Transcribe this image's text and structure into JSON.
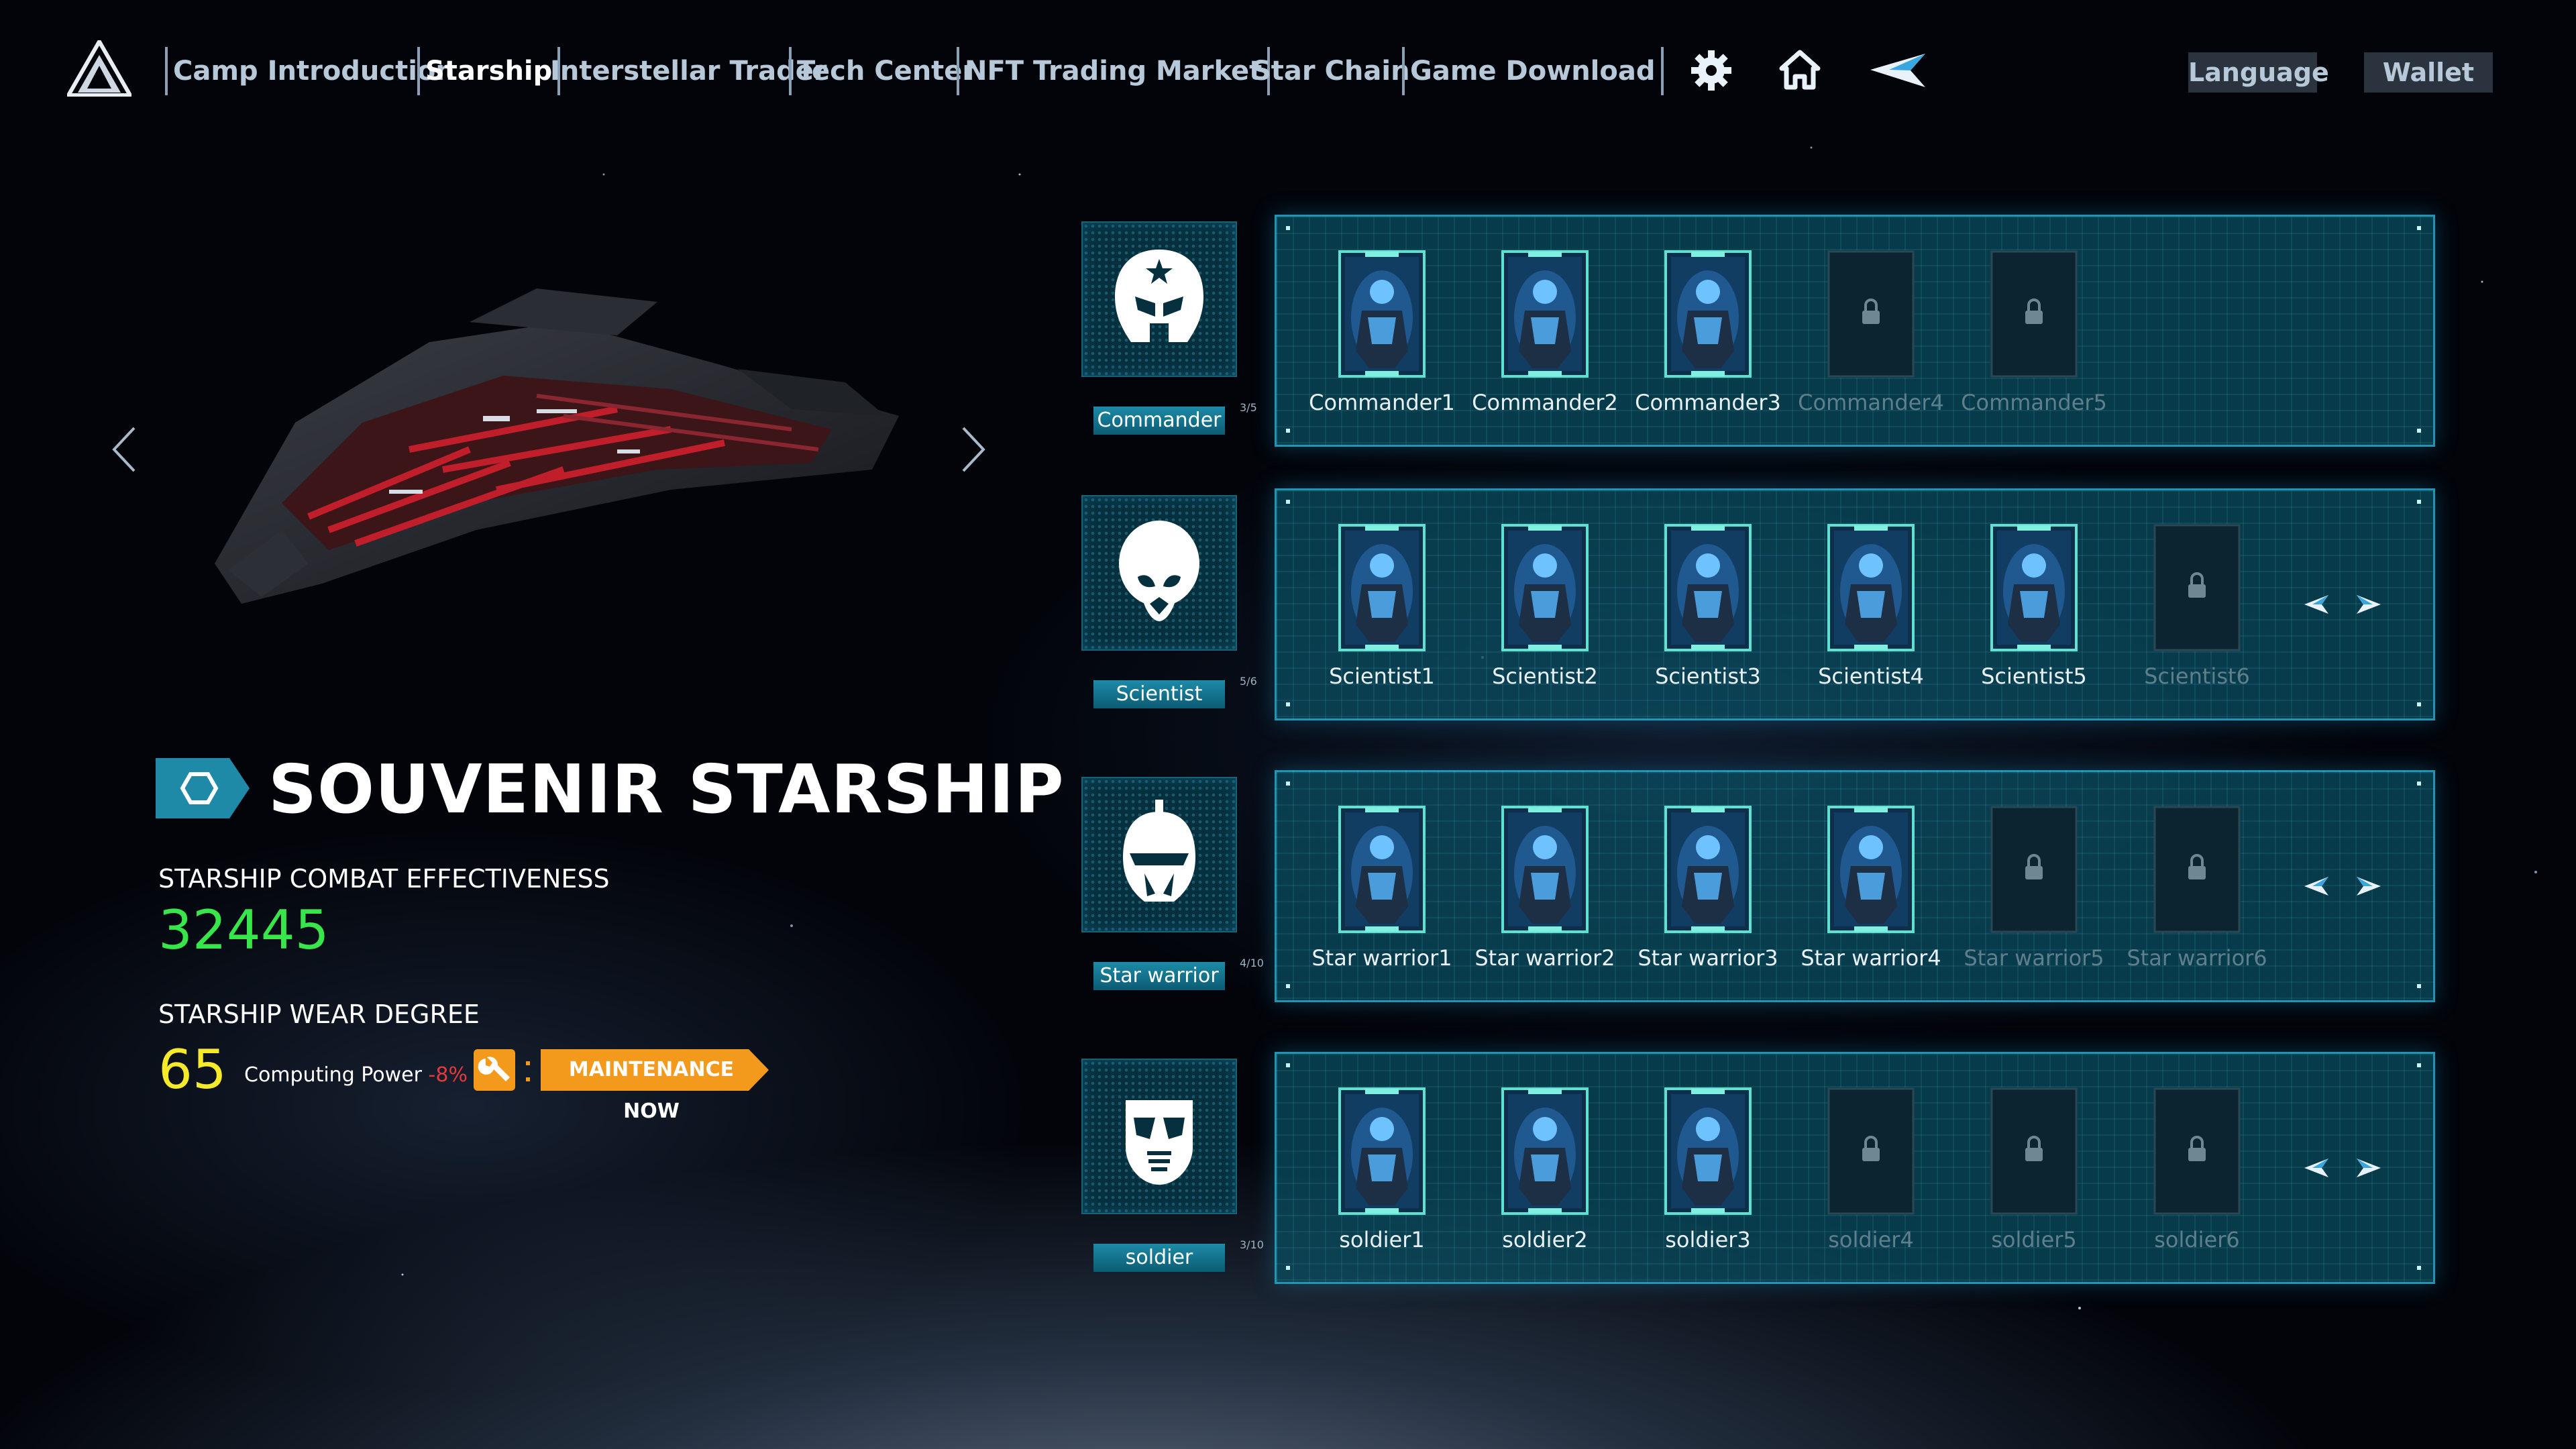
{
  "nav": {
    "items": [
      {
        "label": "Camp Introduction"
      },
      {
        "label": "Starship"
      },
      {
        "label": "Interstellar Trader"
      },
      {
        "label": "Tech Center"
      },
      {
        "label": "NFT Trading Market"
      },
      {
        "label": "Star Chain"
      },
      {
        "label": "Game Download"
      }
    ],
    "active_index": 1,
    "icons": [
      "gear-icon",
      "home-icon",
      "paper-plane-icon"
    ],
    "language_label": "Language",
    "wallet_label": "Wallet"
  },
  "ship": {
    "title": "SOUVENIR STARSHIP",
    "combat_label": "STARSHIP COMBAT EFFECTIVENESS",
    "combat_value": "32445",
    "wear_label": "STARSHIP WEAR DEGREE",
    "wear_value": "65",
    "computing_label": "Computing Power",
    "computing_pct": "-8%",
    "maintenance_label": "MAINTENANCE NOW",
    "colors": {
      "combat": "#37e64a",
      "wear": "#f5ea2a",
      "maintenance": "#f39a1c"
    }
  },
  "crew": [
    {
      "role": "Commander",
      "count": "3/5",
      "icon": "commander-helmet-icon",
      "has_pager": false,
      "slots": [
        {
          "label": "Commander1",
          "locked": false
        },
        {
          "label": "Commander2",
          "locked": false
        },
        {
          "label": "Commander3",
          "locked": false
        },
        {
          "label": "Commander4",
          "locked": true
        },
        {
          "label": "Commander5",
          "locked": true
        }
      ]
    },
    {
      "role": "Scientist",
      "count": "5/6",
      "icon": "scientist-alien-icon",
      "has_pager": true,
      "slots": [
        {
          "label": "Scientist1",
          "locked": false
        },
        {
          "label": "Scientist2",
          "locked": false
        },
        {
          "label": "Scientist3",
          "locked": false
        },
        {
          "label": "Scientist4",
          "locked": false
        },
        {
          "label": "Scientist5",
          "locked": false
        },
        {
          "label": "Scientist6",
          "locked": true
        }
      ]
    },
    {
      "role": "Star warrior",
      "count": "4/10",
      "icon": "star-warrior-helmet-icon",
      "has_pager": true,
      "slots": [
        {
          "label": "Star warrior1",
          "locked": false
        },
        {
          "label": "Star warrior2",
          "locked": false
        },
        {
          "label": "Star warrior3",
          "locked": false
        },
        {
          "label": "Star warrior4",
          "locked": false
        },
        {
          "label": "Star warrior5",
          "locked": true
        },
        {
          "label": "Star warrior6",
          "locked": true
        }
      ]
    },
    {
      "role": "soldier",
      "count": "3/10",
      "icon": "soldier-mask-icon",
      "has_pager": true,
      "slots": [
        {
          "label": "soldier1",
          "locked": false
        },
        {
          "label": "soldier2",
          "locked": false
        },
        {
          "label": "soldier3",
          "locked": false
        },
        {
          "label": "soldier4",
          "locked": true
        },
        {
          "label": "soldier5",
          "locked": true
        },
        {
          "label": "soldier6",
          "locked": true
        }
      ]
    }
  ]
}
